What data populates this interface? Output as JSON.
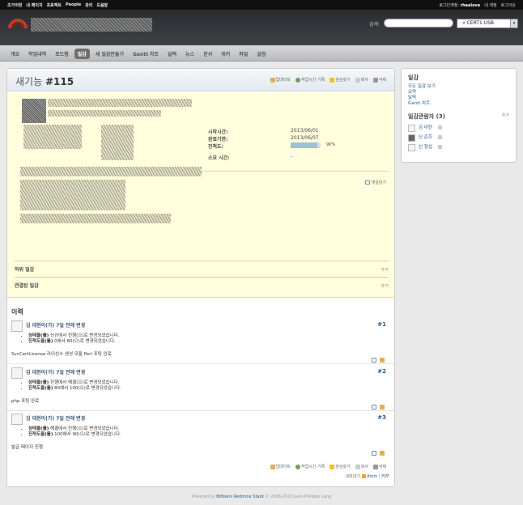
{
  "topbar": {
    "left_links": [
      "조가이번",
      "내 페이지",
      "프로젝트",
      "People",
      "관리",
      "도움말"
    ],
    "login_label": "로그인계정:",
    "login_user": "rhealove",
    "account": "내 계정",
    "logout": "로그아웃"
  },
  "header": {
    "search_label": "검색:",
    "search_value": "",
    "project_select": "» CERT1 USB"
  },
  "menu": {
    "tabs": [
      "개요",
      "작업내역",
      "로드맵",
      "일감",
      "새 일감만들기",
      "Gantt 차트",
      "달력",
      "뉴스",
      "문서",
      "위키",
      "파일",
      "설정"
    ],
    "selected": "일감"
  },
  "issue": {
    "tracker": "새기능",
    "number": "#115",
    "actions": [
      "업데이트",
      "작업시간 기록",
      "관심갖기",
      "복사",
      "삭제"
    ],
    "attributes": [
      {
        "label": "시작시간:",
        "value": "2013/06/01"
      },
      {
        "label": "완료기한:",
        "value": "2013/06/07"
      },
      {
        "label": "진척도:",
        "value": "90%"
      },
      {
        "label": "소요 시간:",
        "value": "-"
      }
    ],
    "progress": 0.9,
    "quote": "댓글달기",
    "subtasks": "하위 일감",
    "related": "연결된 일감",
    "add_label": "추가"
  },
  "history": {
    "title": "이력",
    "journals": [
      {
        "header": "김 대현이(가) 7일 전에 변경",
        "number": "#1",
        "changes": [
          {
            "field": "상태을(를)",
            "text": " 신규에서 진행(으)로 변경되었습니다."
          },
          {
            "field": "진척도을(를)",
            "text": " 0에서 80(으)로 변경되었습니다."
          }
        ],
        "note": "SvcCertLicense 라이선스 생성 모듈 Perl 포팅 완료"
      },
      {
        "header": "김 대현이(가) 7일 전에 변경",
        "number": "#2",
        "changes": [
          {
            "field": "상태을(를)",
            "text": " 진행에서 해결(으)로 변경되었습니다."
          },
          {
            "field": "진척도을(를)",
            "text": " 80에서 100(으)로 변경되었습니다."
          }
        ],
        "note": "php 포팅 완료"
      },
      {
        "header": "김 대현이(가) 7일 전에 변경",
        "number": "#3",
        "changes": [
          {
            "field": "상태을(를)",
            "text": " 해결에서 진행(으)로 변경되었습니다."
          },
          {
            "field": "진척도을(를)",
            "text": " 100에서 90(으)로 변경되었습니다."
          }
        ],
        "note": "발급 페이지 진행"
      }
    ],
    "export_label": "내보내기",
    "export_atom": "Atom",
    "export_pdf": "PDF"
  },
  "sidebar": {
    "issues_title": "일감",
    "issue_links": [
      "모든 일감 보기",
      "요약",
      "달력",
      "Gantt 차트"
    ],
    "watchers_title": "일감관람자 (3)",
    "watchers_add": "추가",
    "watchers": [
      "김 대현",
      "신 준희",
      "신 형섭"
    ]
  },
  "footer": {
    "powered": "Powered by",
    "link": "BitNami Redmine Stack",
    "copy": "© 2006-2013 Jean-Philippe Lang"
  },
  "colors": {
    "issue_bg": "#ffffdd",
    "link": "#2a5a8a",
    "progress": "#9fc0d9"
  }
}
